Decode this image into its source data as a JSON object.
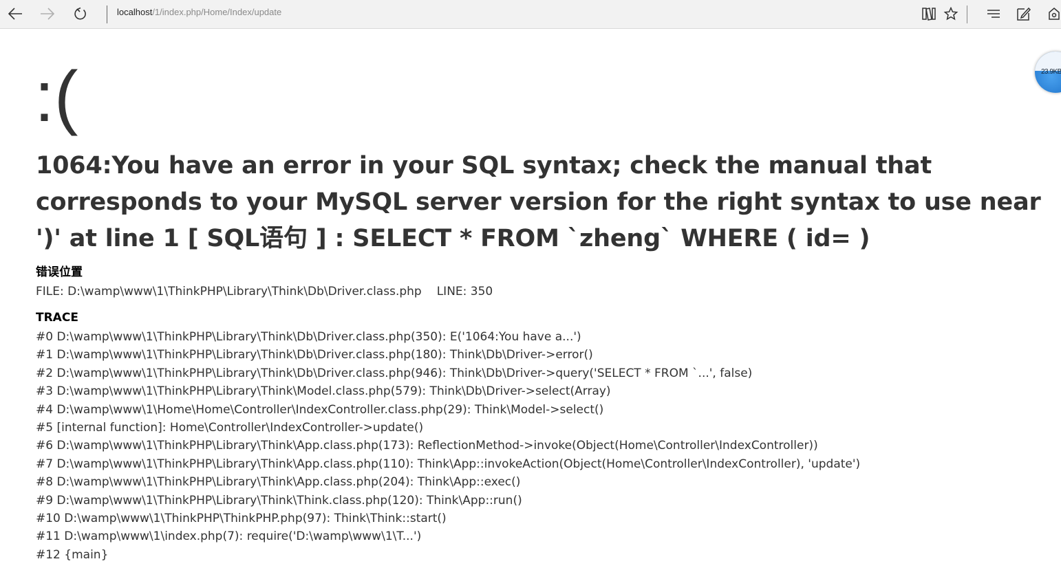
{
  "browser": {
    "url_host": "localhost",
    "url_path": "/1/index.php/Home/Index/update"
  },
  "widget": {
    "speed": "23.9KB"
  },
  "page": {
    "face": ":(",
    "error_message": "1064:You have an error in your SQL syntax; check the manual that corresponds to your MySQL server version for the right syntax to use near ')' at line 1 [ SQL语句 ] : SELECT * FROM `zheng` WHERE ( id= )",
    "location_title": "错误位置",
    "file_label": "FILE: D:\\wamp\\www\\1\\ThinkPHP\\Library\\Think\\Db\\Driver.class.php",
    "line_label": "LINE: 350",
    "trace_title": "TRACE",
    "trace": [
      "#0 D:\\wamp\\www\\1\\ThinkPHP\\Library\\Think\\Db\\Driver.class.php(350): E('1064:You have a...')",
      "#1 D:\\wamp\\www\\1\\ThinkPHP\\Library\\Think\\Db\\Driver.class.php(180): Think\\Db\\Driver->error()",
      "#2 D:\\wamp\\www\\1\\ThinkPHP\\Library\\Think\\Db\\Driver.class.php(946): Think\\Db\\Driver->query('SELECT * FROM `...', false)",
      "#3 D:\\wamp\\www\\1\\ThinkPHP\\Library\\Think\\Model.class.php(579): Think\\Db\\Driver->select(Array)",
      "#4 D:\\wamp\\www\\1\\Home\\Home\\Controller\\IndexController.class.php(29): Think\\Model->select()",
      "#5 [internal function]: Home\\Controller\\IndexController->update()",
      "#6 D:\\wamp\\www\\1\\ThinkPHP\\Library\\Think\\App.class.php(173): ReflectionMethod->invoke(Object(Home\\Controller\\IndexController))",
      "#7 D:\\wamp\\www\\1\\ThinkPHP\\Library\\Think\\App.class.php(110): Think\\App::invokeAction(Object(Home\\Controller\\IndexController), 'update')",
      "#8 D:\\wamp\\www\\1\\ThinkPHP\\Library\\Think\\App.class.php(204): Think\\App::exec()",
      "#9 D:\\wamp\\www\\1\\ThinkPHP\\Library\\Think\\Think.class.php(120): Think\\App::run()",
      "#10 D:\\wamp\\www\\1\\ThinkPHP\\ThinkPHP.php(97): Think\\Think::start()",
      "#11 D:\\wamp\\www\\1\\index.php(7): require('D:\\wamp\\www\\1\\T...')",
      "#12 {main}"
    ]
  },
  "icons": {
    "back": "back-arrow-icon",
    "forward": "forward-arrow-icon",
    "refresh": "refresh-icon",
    "reading_view": "reading-view-icon",
    "favorite": "star-icon",
    "hub": "hub-icon",
    "web_note": "web-note-icon",
    "share": "share-icon"
  },
  "colors": {
    "toolbar_bg": "#f2f2f2",
    "text": "#333333",
    "url_host": "#222222",
    "url_path": "#8a8a8a"
  }
}
